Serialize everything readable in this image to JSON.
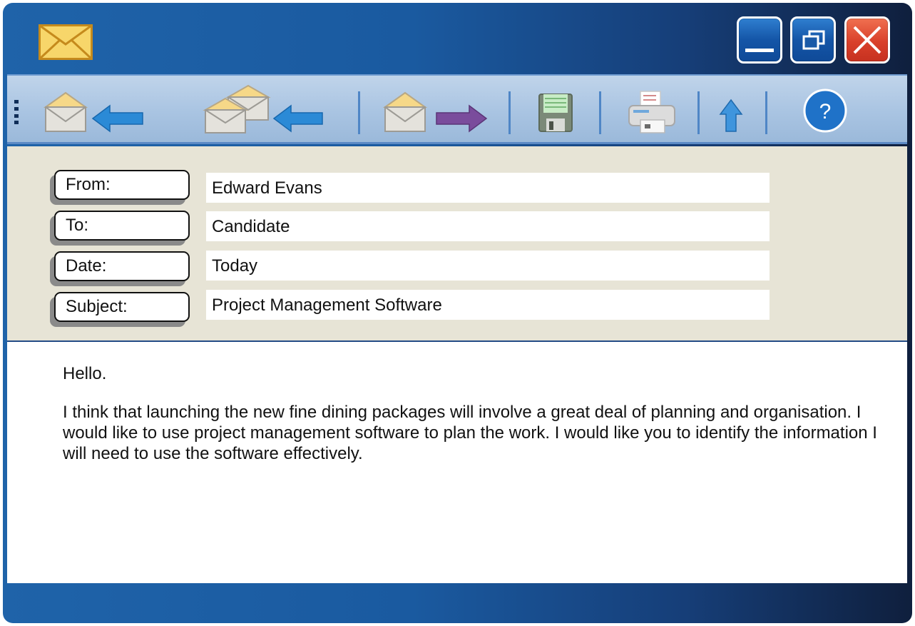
{
  "window": {
    "controls": {
      "minimize": "minimize",
      "maximize": "maximize",
      "close": "close"
    }
  },
  "toolbar": {
    "buttons": [
      {
        "name": "reply",
        "icon": "envelope-left-arrow-icon"
      },
      {
        "name": "reply-all",
        "icon": "double-envelope-left-arrow-icon"
      },
      {
        "name": "forward",
        "icon": "envelope-right-arrow-icon"
      },
      {
        "name": "save",
        "icon": "floppy-disk-icon"
      },
      {
        "name": "print",
        "icon": "printer-icon"
      },
      {
        "name": "upload",
        "icon": "up-arrow-icon"
      },
      {
        "name": "help",
        "icon": "help-icon",
        "label": "?"
      }
    ]
  },
  "email": {
    "fields": [
      {
        "label": "From:",
        "value": "Edward Evans"
      },
      {
        "label": "To:",
        "value": "Candidate"
      },
      {
        "label": "Date:",
        "value": "Today"
      },
      {
        "label": "Subject:",
        "value": "Project Management Software"
      }
    ],
    "body": [
      "Hello.",
      "I think that launching the new fine dining packages will involve a great deal of planning and organisation. I would like to use project management software to plan the work. I would like you to identify the information I will need to use the software effectively."
    ]
  },
  "colors": {
    "titlebar": "#1a5aa0",
    "toolbar": "#a9c4e2",
    "header_panel": "#e7e4d6",
    "close_button": "#d9402a"
  }
}
